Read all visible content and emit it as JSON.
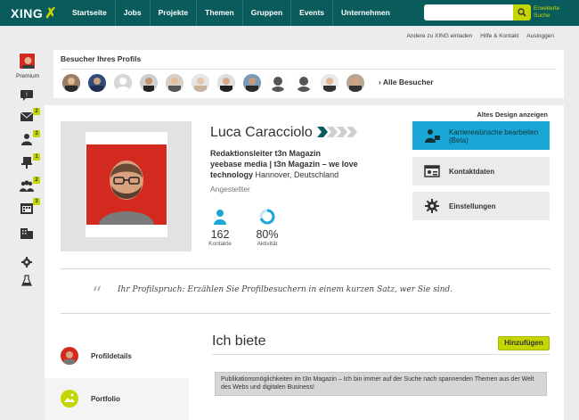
{
  "header": {
    "logo": "XING",
    "nav": [
      "Startseite",
      "Jobs",
      "Projekte",
      "Themen",
      "Gruppen",
      "Events",
      "Unternehmen"
    ],
    "search_placeholder": "",
    "advanced_search": "Erweiterte Suche"
  },
  "sublinks": [
    "Andere zu XING einladen",
    "Hilfe & Kontakt",
    "Ausloggen"
  ],
  "rail": {
    "premium_label": "Premium",
    "badges": {
      "messages": "2",
      "contacts": "3",
      "jobs": "1",
      "groups": "2",
      "events": "3"
    }
  },
  "visitors": {
    "title": "Besucher Ihres Profils",
    "all_label": "Alle Besucher",
    "count": 12
  },
  "profile": {
    "old_design": "Altes Design anzeigen",
    "name": "Luca Caracciolo",
    "job_title": "Redaktionsleiter t3n Magazin",
    "company": "yeebase media | t3n Magazin – we love technology",
    "location": "Hannover, Deutschland",
    "status": "Angestellter",
    "contacts_value": "162",
    "contacts_label": "Kontakte",
    "activity_value": "80%",
    "activity_label": "Aktivität",
    "actions": {
      "career": "Karrierewünsche bearbeiten",
      "career_sub": "(Beta)",
      "contact": "Kontaktdaten",
      "settings": "Einstellungen"
    },
    "quote": "Ihr Profilspruch: Erzählen Sie Profilbesuchern in einem kurzen Satz, wer Sie sind.",
    "tabs": {
      "details": "Profildetails",
      "portfolio": "Portfolio"
    },
    "offer_title": "Ich biete",
    "add_button": "Hinzufügen",
    "offer_text": "Publikationsmöglichkeiten im t3n Magazin – Ich bin immer auf der Suche nach spannenden Themen aus der Welt des Webs und digitalen Business!"
  },
  "colors": {
    "brand": "#0a5b5b",
    "accent": "#c4d600",
    "primary_action": "#1aa6d6"
  }
}
